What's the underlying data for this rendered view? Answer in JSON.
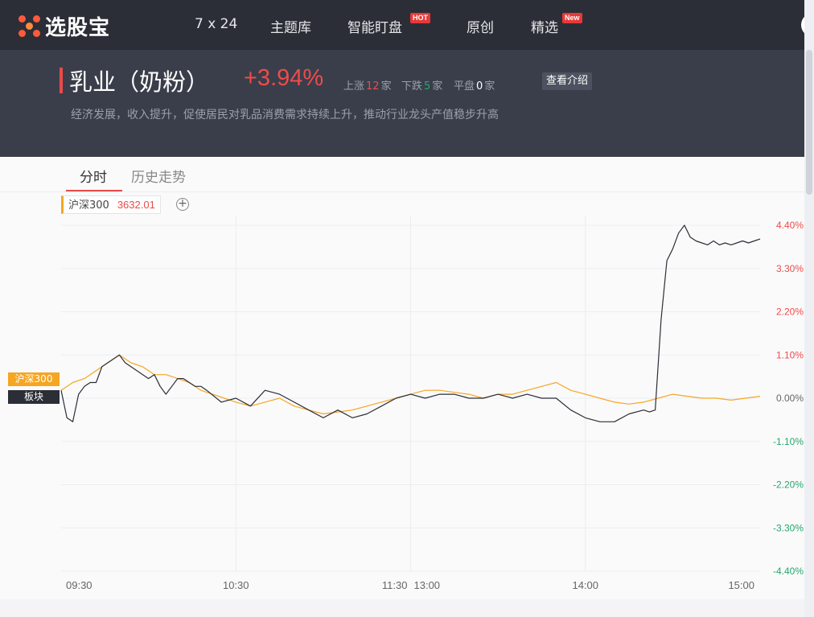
{
  "nav": {
    "logo_text": "选股宝",
    "items": [
      {
        "label": "7 x 24"
      },
      {
        "label": "主题库"
      },
      {
        "label": "智能盯盘",
        "badge": "HOT"
      },
      {
        "label": "原创"
      },
      {
        "label": "精选",
        "badge": "New"
      }
    ]
  },
  "header": {
    "sector_name": "乳业（奶粉）",
    "change": "+3.94%",
    "rise_label": "上涨",
    "rise_count": "12",
    "fall_label": "下跌",
    "fall_count": "5",
    "flat_label": "平盘",
    "flat_count": "0",
    "unit": "家",
    "intro_button": "查看介绍",
    "description": "经济发展，收入提升，促使居民对乳品消费需求持续上升，推动行业龙头产值稳步升高"
  },
  "tabs": [
    {
      "label": "分时",
      "active": true
    },
    {
      "label": "历史走势",
      "active": false
    }
  ],
  "legend": {
    "index_name": "沪深300",
    "index_value": "3632.01"
  },
  "tags": {
    "hs300": "沪深300",
    "sector": "板块"
  },
  "colors": {
    "up": "#ef4b4b",
    "down": "#23a86b",
    "hs300_line": "#f5a623",
    "sector_line": "#2b2e36"
  },
  "chart_data": {
    "type": "line",
    "x_ticks": [
      "09:30",
      "10:30",
      "11:30",
      "13:00",
      "14:00",
      "15:00"
    ],
    "y_ticks": [
      "4.40%",
      "3.30%",
      "2.20%",
      "1.10%",
      "0.00%",
      "-1.10%",
      "-2.20%",
      "-3.30%",
      "-4.40%"
    ],
    "ylim": [
      -4.4,
      4.4
    ],
    "x_unit": "trading minutes from 09:30 (0-240)",
    "series": [
      {
        "name": "板块",
        "color": "#2b2e36",
        "x": [
          0,
          2,
          4,
          6,
          8,
          10,
          12,
          14,
          16,
          18,
          20,
          22,
          24,
          26,
          28,
          30,
          32,
          34,
          36,
          38,
          40,
          42,
          44,
          46,
          48,
          50,
          55,
          60,
          65,
          70,
          75,
          80,
          85,
          90,
          95,
          100,
          105,
          110,
          115,
          120,
          125,
          130,
          135,
          140,
          145,
          150,
          155,
          160,
          165,
          170,
          175,
          180,
          185,
          190,
          195,
          200,
          202,
          204,
          206,
          208,
          210,
          212,
          214,
          216,
          218,
          220,
          222,
          224,
          226,
          228,
          230,
          232,
          234,
          236,
          238,
          240
        ],
        "values": [
          0.2,
          -0.5,
          -0.6,
          0.1,
          0.3,
          0.4,
          0.4,
          0.8,
          0.9,
          1.0,
          1.1,
          0.9,
          0.8,
          0.7,
          0.6,
          0.5,
          0.6,
          0.3,
          0.1,
          0.3,
          0.5,
          0.5,
          0.4,
          0.3,
          0.3,
          0.2,
          -0.1,
          0.0,
          -0.2,
          0.2,
          0.1,
          -0.1,
          -0.3,
          -0.5,
          -0.3,
          -0.5,
          -0.4,
          -0.2,
          0.0,
          0.1,
          0.0,
          0.1,
          0.1,
          0.0,
          0.0,
          0.1,
          0.0,
          0.1,
          0.0,
          0.0,
          -0.3,
          -0.5,
          -0.6,
          -0.6,
          -0.4,
          -0.3,
          -0.35,
          -0.3,
          2.0,
          3.5,
          3.8,
          4.2,
          4.4,
          4.1,
          4.0,
          3.95,
          3.9,
          4.0,
          3.9,
          3.95,
          3.9,
          3.95,
          4.0,
          3.95,
          4.0,
          4.05
        ]
      },
      {
        "name": "沪深300",
        "color": "#f5a623",
        "x": [
          0,
          4,
          8,
          12,
          16,
          20,
          24,
          28,
          32,
          36,
          40,
          44,
          48,
          52,
          56,
          60,
          65,
          70,
          75,
          80,
          85,
          90,
          95,
          100,
          105,
          110,
          115,
          120,
          125,
          130,
          135,
          140,
          145,
          150,
          155,
          160,
          165,
          170,
          175,
          180,
          185,
          190,
          195,
          200,
          205,
          210,
          215,
          220,
          225,
          230,
          235,
          240
        ],
        "values": [
          0.2,
          0.4,
          0.5,
          0.7,
          0.9,
          1.1,
          0.9,
          0.8,
          0.6,
          0.6,
          0.5,
          0.4,
          0.2,
          0.1,
          0.0,
          -0.1,
          -0.2,
          -0.1,
          0.0,
          -0.2,
          -0.3,
          -0.4,
          -0.35,
          -0.3,
          -0.2,
          -0.1,
          0.0,
          0.1,
          0.2,
          0.2,
          0.15,
          0.1,
          0.0,
          0.1,
          0.1,
          0.2,
          0.3,
          0.4,
          0.2,
          0.1,
          0.0,
          -0.1,
          -0.15,
          -0.1,
          0.0,
          0.1,
          0.05,
          0.0,
          0.0,
          -0.05,
          0.0,
          0.05
        ]
      }
    ]
  }
}
